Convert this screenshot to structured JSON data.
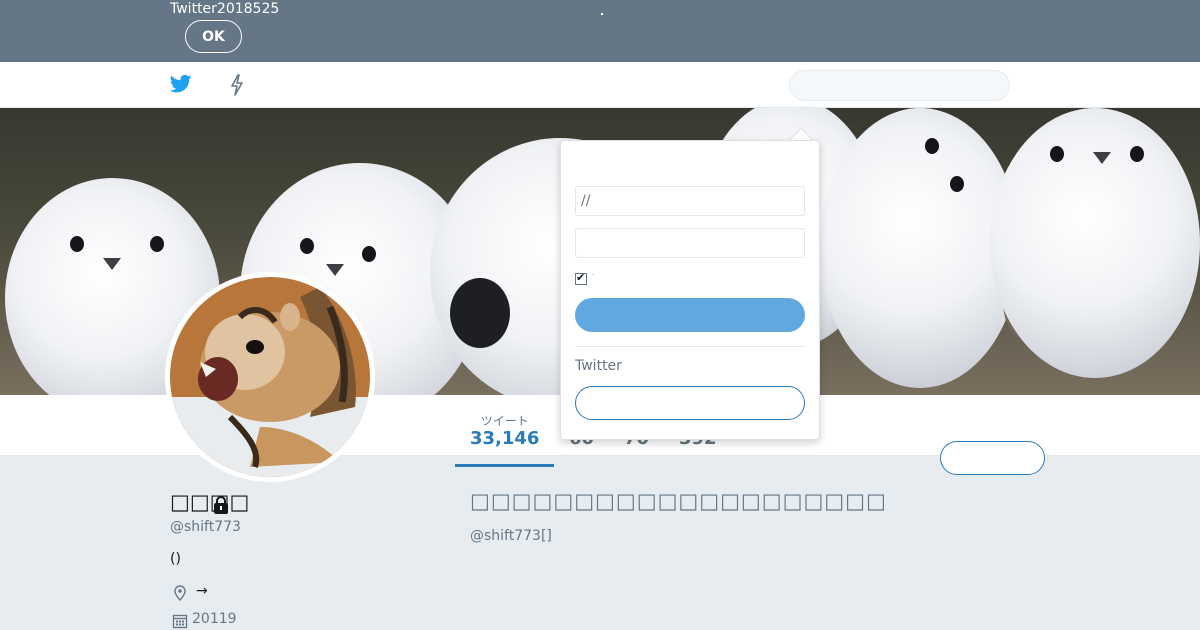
{
  "notification": {
    "text": "Twitter2018525",
    "ok_label": "OK"
  },
  "nav": {
    "search_placeholder": ""
  },
  "profile": {
    "stats": [
      {
        "label": "ツイート",
        "value": "33,146"
      },
      {
        "label": "",
        "value": "60"
      },
      {
        "label": "",
        "value": "70"
      },
      {
        "label": "",
        "value": "392"
      }
    ],
    "name": "□□□□",
    "handle": "@shift773",
    "bio": "()",
    "location": "→",
    "joined": "20119",
    "follow_label": ""
  },
  "protected": {
    "title": "□□□□□□□□□□□□□□□□□□□□",
    "subtitle": "@shift773[]"
  },
  "login": {
    "username_placeholder": "//",
    "password_placeholder": "",
    "remember_label": "·",
    "login_label": "",
    "signup_prompt": "Twitter",
    "signup_label": ""
  },
  "colors": {
    "notice_bar": "#657786",
    "twitter_blue": "#1da1f2",
    "accent": "#2b7bb9",
    "login_button": "#62a8e0"
  },
  "icons": [
    "twitter-bird-icon",
    "moments-bolt-icon",
    "search-icon",
    "lock-icon",
    "location-icon",
    "calendar-icon"
  ]
}
